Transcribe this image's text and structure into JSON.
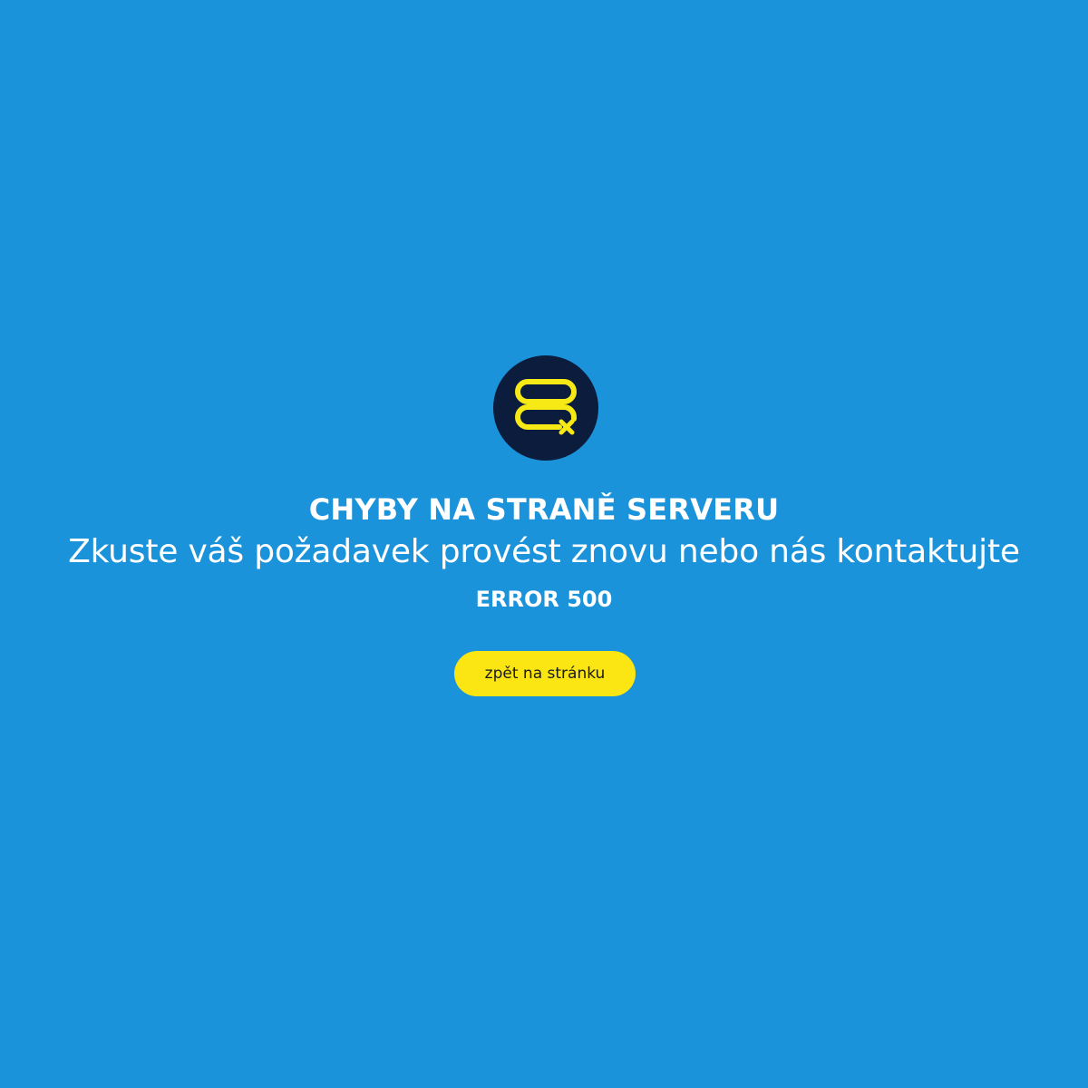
{
  "page": {
    "background_color": "#1b93da"
  },
  "icon": {
    "name": "server-error-icon",
    "badge_color": "#0c1c3c",
    "accent_color": "#f6e915"
  },
  "content": {
    "title": "CHYBY NA STRANĚ SERVERU",
    "subtitle": "Zkuste váš požadavek provést znovu nebo nás kontaktujte",
    "error_code": "ERROR 500"
  },
  "actions": {
    "back_label": "zpět na stránku",
    "back_button_color": "#fbe513"
  }
}
